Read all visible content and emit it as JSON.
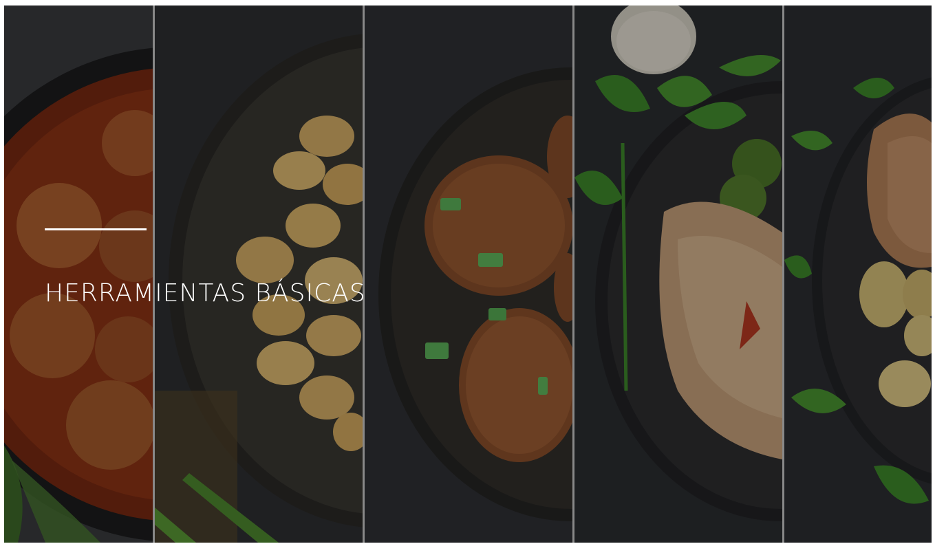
{
  "title": "HERRAMIENTAS BÁSICAS",
  "panels": [
    {
      "name": "meatballs-in-tomato-sauce",
      "icon": "meatballs-image"
    },
    {
      "name": "roasted-potatoes",
      "icon": "potatoes-image"
    },
    {
      "name": "meat-patties",
      "icon": "patties-image"
    },
    {
      "name": "grilled-chicken-breast",
      "icon": "chicken-breast-image"
    },
    {
      "name": "chicken-with-potatoes",
      "icon": "chicken-potatoes-image"
    }
  ],
  "colors": {
    "background": "#2a2c30",
    "divider": "#c9c9c9",
    "text": "#ffffff"
  }
}
